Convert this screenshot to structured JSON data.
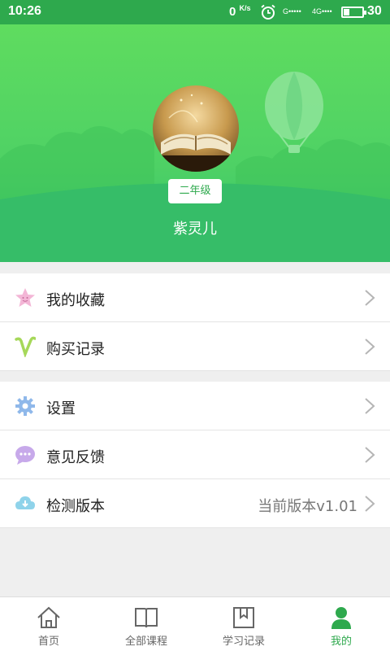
{
  "status_bar": {
    "time": "10:26",
    "speed": "0",
    "speed_unit": "K/s",
    "signal1": "G•••••",
    "signal2": "4G••••",
    "battery": "30"
  },
  "profile": {
    "grade": "二年级",
    "username": "紫灵儿"
  },
  "menu": {
    "group1": [
      {
        "label": "我的收藏",
        "icon": "star-face-icon"
      },
      {
        "label": "购买记录",
        "icon": "v-icon"
      }
    ],
    "group2": [
      {
        "label": "设置",
        "icon": "gear-icon"
      },
      {
        "label": "意见反馈",
        "icon": "chat-bubble-icon"
      },
      {
        "label": "检测版本",
        "icon": "cloud-download-icon",
        "value": "当前版本v1.01"
      }
    ]
  },
  "tabs": [
    {
      "label": "首页",
      "icon": "home-icon"
    },
    {
      "label": "全部课程",
      "icon": "book-icon"
    },
    {
      "label": "学习记录",
      "icon": "bookmark-book-icon"
    },
    {
      "label": "我的",
      "icon": "person-icon",
      "active": true
    }
  ],
  "colors": {
    "brand_green": "#2ea94d",
    "header_green": "#4ed165"
  }
}
